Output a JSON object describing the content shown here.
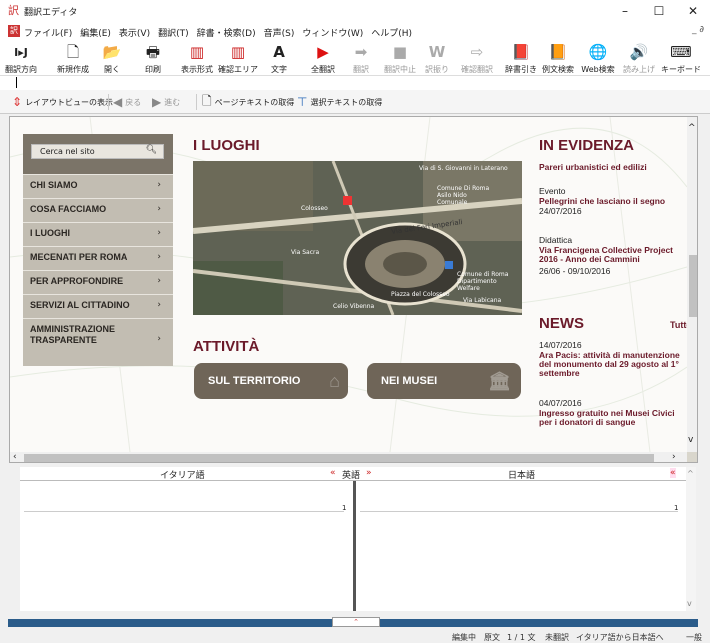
{
  "window": {
    "title": "翻訳エディタ",
    "minimize": "–",
    "maximize": "☐",
    "close": "✕"
  },
  "menu": {
    "items": [
      "ファイル(F)",
      "編集(E)",
      "表示(V)",
      "翻訳(T)",
      "辞書・検索(D)",
      "音声(S)",
      "ウィンドウ(W)",
      "ヘルプ(H)"
    ],
    "mdi_controls": "_ ∂"
  },
  "toolbar": {
    "buttons": [
      {
        "label": "翻訳方向",
        "icon": "I▸J"
      },
      {
        "label": "新規作成",
        "icon": "🗋"
      },
      {
        "label": "開く",
        "icon": "📂"
      },
      {
        "label": "印刷",
        "icon": "🖶"
      },
      {
        "label": "表示形式",
        "icon": "▥"
      },
      {
        "label": "確認エリア",
        "icon": "▥"
      },
      {
        "label": "文字",
        "icon": "A"
      },
      {
        "label": "全翻訳",
        "icon": "▶"
      },
      {
        "label": "翻訳",
        "icon": "➡"
      },
      {
        "label": "翻訳中止",
        "icon": "■"
      },
      {
        "label": "訳振り",
        "icon": "W"
      },
      {
        "label": "確認翻訳",
        "icon": "⇨"
      },
      {
        "label": "辞書引き",
        "icon": "📕"
      },
      {
        "label": "例文検索",
        "icon": "📙"
      },
      {
        "label": "Web検索",
        "icon": "🌐"
      },
      {
        "label": "読み上げ",
        "icon": "🔊"
      },
      {
        "label": "キーボード",
        "icon": "⌨"
      }
    ]
  },
  "navbar": {
    "layout_view": "レイアウトビューの表示",
    "back": "戻る",
    "forward": "進む",
    "get_page_text": "ページテキストの取得",
    "get_selected_text": "選択テキストの取得"
  },
  "site": {
    "search_placeholder": "Cerca nel sito",
    "nav": [
      "CHI SIAMO",
      "COSA FACCIAMO",
      "I LUOGHI",
      "MECENATI PER ROMA",
      "PER APPROFONDIRE",
      "SERVIZI AL CITTADINO",
      "AMMINISTRAZIONE TRASPARENTE"
    ],
    "luoghi_title": "I LUOGHI",
    "map_labels": [
      "Colosseo",
      "Comune Di Roma Asilo Nido Comunale",
      "Via dei Fori Imperiali",
      "Via Sacra",
      "Comune di Roma Dipartimento Welfare",
      "Piazza del Colosseo",
      "Via Labicana",
      "Via di S. Giovanni in Laterano",
      "Celio Vibenna"
    ],
    "attivita_title": "ATTIVITÀ",
    "btn_territorio": "SUL TERRITORIO",
    "btn_musei": "NEI MUSEI",
    "evidenza_title": "IN EVIDENZA",
    "evidenza_items": [
      {
        "tag": "",
        "title": "Pareri urbanistici ed edilizi",
        "date": ""
      },
      {
        "tag": "Evento",
        "title": "Pellegrini che lasciano il segno",
        "date": "24/07/2016"
      },
      {
        "tag": "Didattica",
        "title": "Via Francigena Collective Project 2016 - Anno dei Cammini",
        "date": "26/06 - 09/10/2016"
      }
    ],
    "news_title": "NEWS",
    "news_all": "Tutte",
    "news_items": [
      {
        "date": "14/07/2016",
        "title": "Ara Pacis: attività di manutenzione del monumento dal 29 agosto al 1° settembre"
      },
      {
        "date": "04/07/2016",
        "title": "Ingresso gratuito nei Musei Civici per i donatori di sangue"
      }
    ]
  },
  "translation": {
    "left_lang": "イタリア語",
    "middle_lang": "英語",
    "right_lang": "日本語",
    "left_line_no": "1",
    "right_line_no": "1"
  },
  "status": {
    "mode": "編集中",
    "view": "原文",
    "sentence": "1 / 1 文",
    "state": "未翻訳",
    "direction": "イタリア語から日本語へ",
    "field": "一般"
  }
}
